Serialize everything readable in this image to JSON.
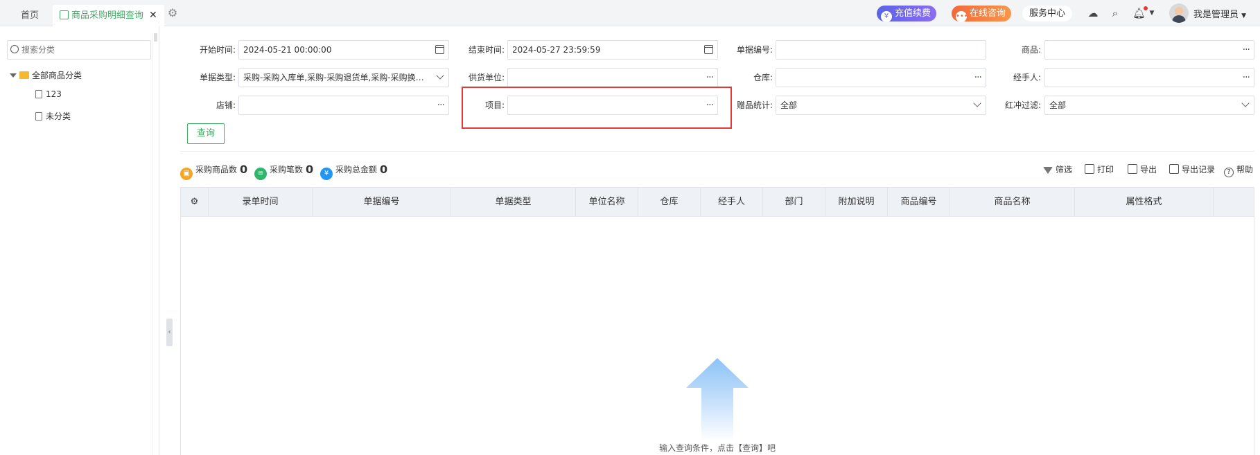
{
  "tabs": {
    "home": "首页",
    "active": "商品采购明细查询",
    "close": "✕"
  },
  "header": {
    "renew": "充值续费",
    "consult": "在线咨询",
    "service": "服务中心",
    "user": "我是管理员"
  },
  "sidebar": {
    "search_placeholder": "搜索分类",
    "root": "全部商品分类",
    "items": [
      "123",
      "未分类"
    ]
  },
  "form": {
    "start_label": "开始时间:",
    "start_value": "2024-05-21 00:00:00",
    "end_label": "结束时间:",
    "end_value": "2024-05-27 23:59:59",
    "docno_label": "单据编号:",
    "docno_value": "",
    "goods_label": "商品:",
    "goods_value": "",
    "doctype_label": "单据类型:",
    "doctype_value": "采购-采购入库单,采购-采购退货单,采购-采购换货单",
    "supplier_label": "供货单位:",
    "supplier_value": "",
    "warehouse_label": "仓库:",
    "warehouse_value": "",
    "handler_label": "经手人:",
    "handler_value": "",
    "store_label": "店铺:",
    "store_value": "",
    "project_label": "项目:",
    "project_value": "",
    "gift_label": "赠品统计:",
    "gift_value": "全部",
    "redflush_label": "红冲过滤:",
    "redflush_value": "全部",
    "query_button": "查询"
  },
  "stats": {
    "goods_count_label": "采购商品数",
    "goods_count": "0",
    "orders_label": "采购笔数",
    "orders": "0",
    "amount_label": "采购总金额",
    "amount": "0"
  },
  "actions": {
    "filter": "筛选",
    "print": "打印",
    "export": "导出",
    "export_log": "导出记录",
    "help": "帮助"
  },
  "table": {
    "columns": [
      "录单时间",
      "单据编号",
      "单据类型",
      "单位名称",
      "仓库",
      "经手人",
      "部门",
      "附加说明",
      "商品编号",
      "商品名称",
      "属性格式"
    ]
  },
  "empty": {
    "message": "输入查询条件，点击【查询】吧"
  },
  "colors": {
    "accent": "#3daf63",
    "highlight": "#e53935",
    "renew": "#6a66ec",
    "consult": "#f47c42"
  }
}
